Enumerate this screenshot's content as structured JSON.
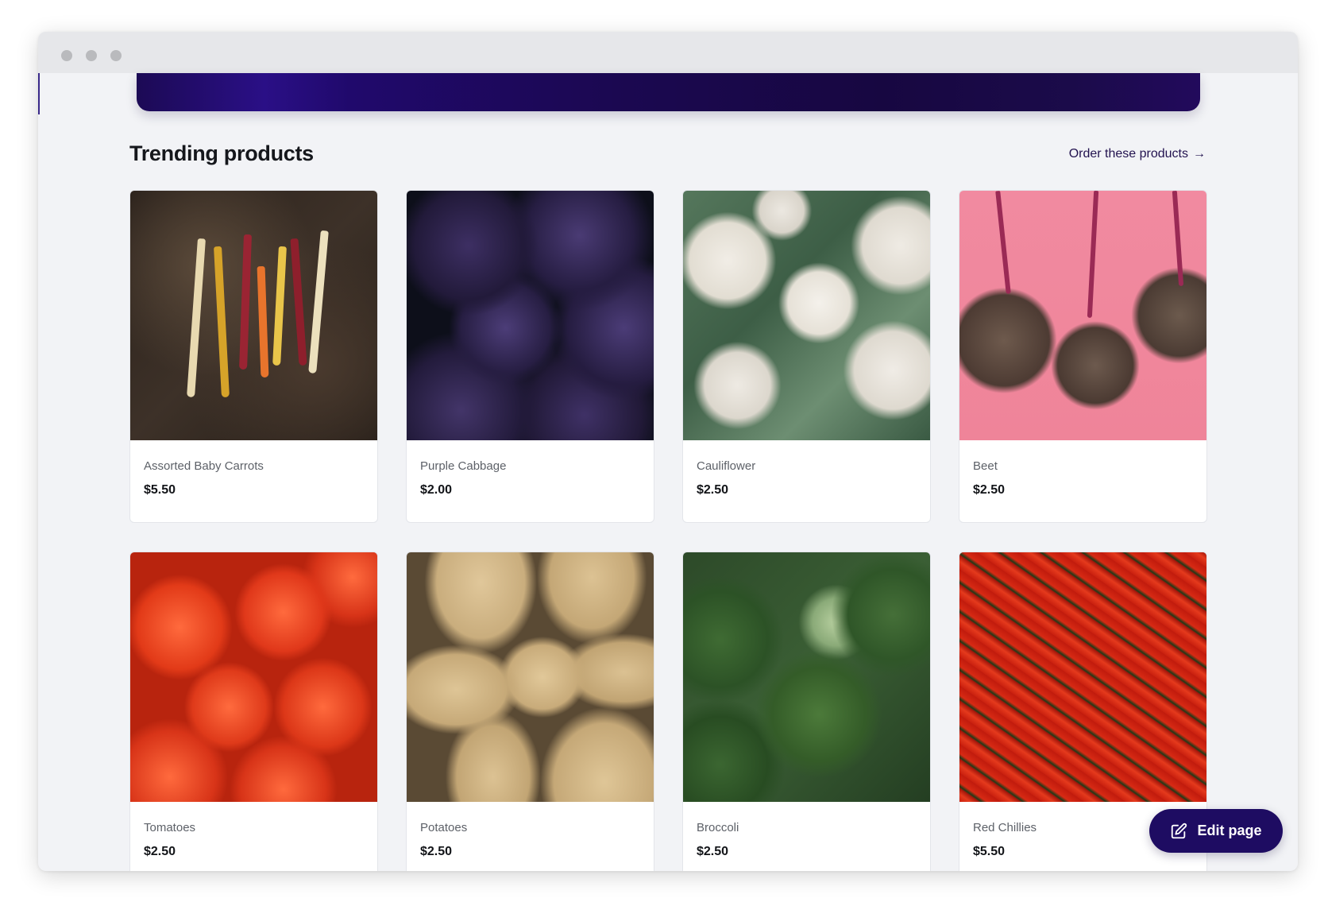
{
  "section": {
    "title": "Trending products",
    "order_link": "Order these products",
    "order_arrow": "→"
  },
  "products": [
    {
      "name": "Assorted Baby Carrots",
      "price": "$5.50",
      "image": "carrots-photo"
    },
    {
      "name": "Purple Cabbage",
      "price": "$2.00",
      "image": "cabbage-photo"
    },
    {
      "name": "Cauliflower",
      "price": "$2.50",
      "image": "cauliflower-photo"
    },
    {
      "name": "Beet",
      "price": "$2.50",
      "image": "beet-photo"
    },
    {
      "name": "Tomatoes",
      "price": "$2.50",
      "image": "tomatoes-photo"
    },
    {
      "name": "Potatoes",
      "price": "$2.50",
      "image": "potatoes-photo"
    },
    {
      "name": "Broccoli",
      "price": "$2.50",
      "image": "broccoli-photo"
    },
    {
      "name": "Red Chillies",
      "price": "$5.50",
      "image": "chillies-photo"
    }
  ],
  "edit_button": {
    "label": "Edit page",
    "icon": "edit-pencil-icon"
  },
  "colors": {
    "accent": "#1e0c62",
    "hero": "#1b0851",
    "background": "#f2f3f6"
  }
}
